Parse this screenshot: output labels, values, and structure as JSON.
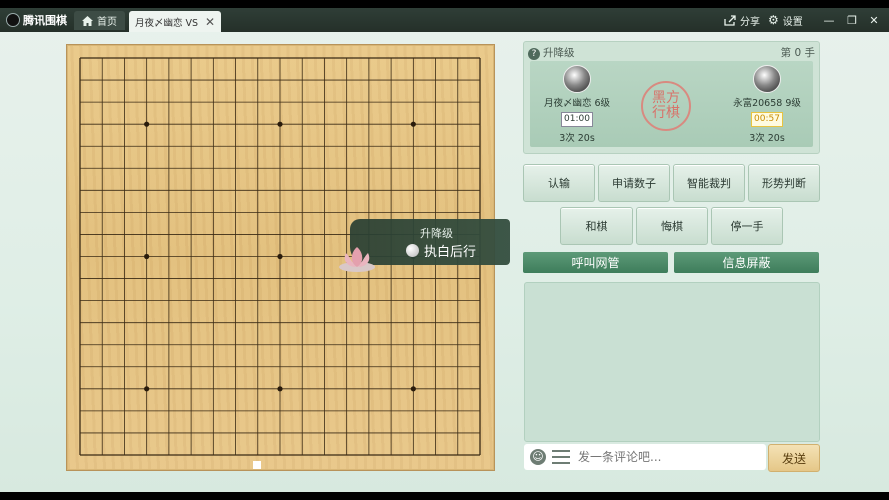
{
  "app": {
    "logo_text": "腾讯围棋"
  },
  "tabs": {
    "home": "首页",
    "game": "月夜〆幽恋 VS"
  },
  "topbar": {
    "share": "分享",
    "settings": "设置"
  },
  "panel": {
    "title": "升降级",
    "move": "第  0  手"
  },
  "players": {
    "left": {
      "name": "月夜〆幽恋 6级",
      "timer": "01:00",
      "stats": "3次  20s"
    },
    "right": {
      "name": "永富20658 9级",
      "timer": "00:57",
      "stats": "3次  20s"
    }
  },
  "seal": {
    "line1": "黑方",
    "line2": "行棋"
  },
  "buttons": {
    "resign": "认输",
    "count": "申请数子",
    "judge": "智能裁判",
    "situation": "形势判断",
    "draw": "和棋",
    "undo": "悔棋",
    "pass": "停一手",
    "call_admin": "呼叫网管",
    "block_info": "信息屏蔽"
  },
  "chat": {
    "placeholder": "发一条评论吧...",
    "send": "发送"
  },
  "notice": {
    "title": "升降级",
    "text": "执白后行"
  },
  "board": {
    "size": 19,
    "stones": []
  }
}
